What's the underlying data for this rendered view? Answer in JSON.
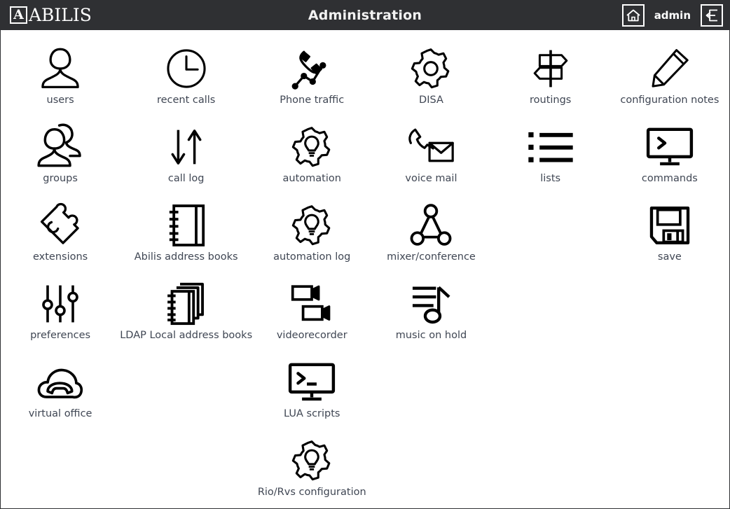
{
  "header": {
    "brand_mark": "A",
    "brand_text": "ABILIS",
    "title": "Administration",
    "username": "admin",
    "home_icon": "home-icon",
    "logout_icon": "logout-icon"
  },
  "grid": {
    "columns": 6,
    "rows": [
      [
        {
          "label": "users",
          "icon": "user-icon"
        },
        {
          "label": "recent calls",
          "icon": "clock-icon"
        },
        {
          "label": "Phone traffic",
          "icon": "phone-traffic-icon"
        },
        {
          "label": "DISA",
          "icon": "gear-icon"
        },
        {
          "label": "routings",
          "icon": "signpost-icon"
        },
        {
          "label": "configuration notes",
          "icon": "pencil-icon"
        }
      ],
      [
        {
          "label": "groups",
          "icon": "users-group-icon"
        },
        {
          "label": "call log",
          "icon": "arrows-down-up-icon"
        },
        {
          "label": "automation",
          "icon": "gear-bulb-icon"
        },
        {
          "label": "voice mail",
          "icon": "voicemail-icon"
        },
        {
          "label": "lists",
          "icon": "bullet-list-icon"
        },
        {
          "label": "commands",
          "icon": "monitor-prompt-icon"
        }
      ],
      [
        {
          "label": "extensions",
          "icon": "puzzle-icon"
        },
        {
          "label": "Abilis address books",
          "icon": "notebook-icon"
        },
        {
          "label": "automation log",
          "icon": "gear-bulb-icon"
        },
        {
          "label": "mixer/conference",
          "icon": "conference-icon"
        },
        {
          "label": "",
          "icon": ""
        },
        {
          "label": "save",
          "icon": "floppy-icon"
        }
      ],
      [
        {
          "label": "preferences",
          "icon": "sliders-icon"
        },
        {
          "label": "LDAP Local address books",
          "icon": "notebooks-stack-icon"
        },
        {
          "label": "videorecorder",
          "icon": "videocamera-icon"
        },
        {
          "label": "music on hold",
          "icon": "music-note-icon"
        },
        {
          "label": "",
          "icon": ""
        },
        {
          "label": "",
          "icon": ""
        }
      ],
      [
        {
          "label": "virtual office",
          "icon": "cloud-phone-icon"
        },
        {
          "label": "",
          "icon": ""
        },
        {
          "label": "LUA scripts",
          "icon": "monitor-terminal-icon"
        },
        {
          "label": "",
          "icon": ""
        },
        {
          "label": "",
          "icon": ""
        },
        {
          "label": "",
          "icon": ""
        }
      ],
      [
        {
          "label": "",
          "icon": ""
        },
        {
          "label": "",
          "icon": ""
        },
        {
          "label": "Rio/Rvs configuration",
          "icon": "gear-bulb-icon"
        },
        {
          "label": "",
          "icon": ""
        },
        {
          "label": "",
          "icon": ""
        },
        {
          "label": "",
          "icon": ""
        }
      ]
    ]
  },
  "colors": {
    "header_bg": "#2f3033",
    "page_bg": "#ffffff",
    "label": "#3f4653",
    "icon": "#000000",
    "header_text": "#ffffff"
  }
}
